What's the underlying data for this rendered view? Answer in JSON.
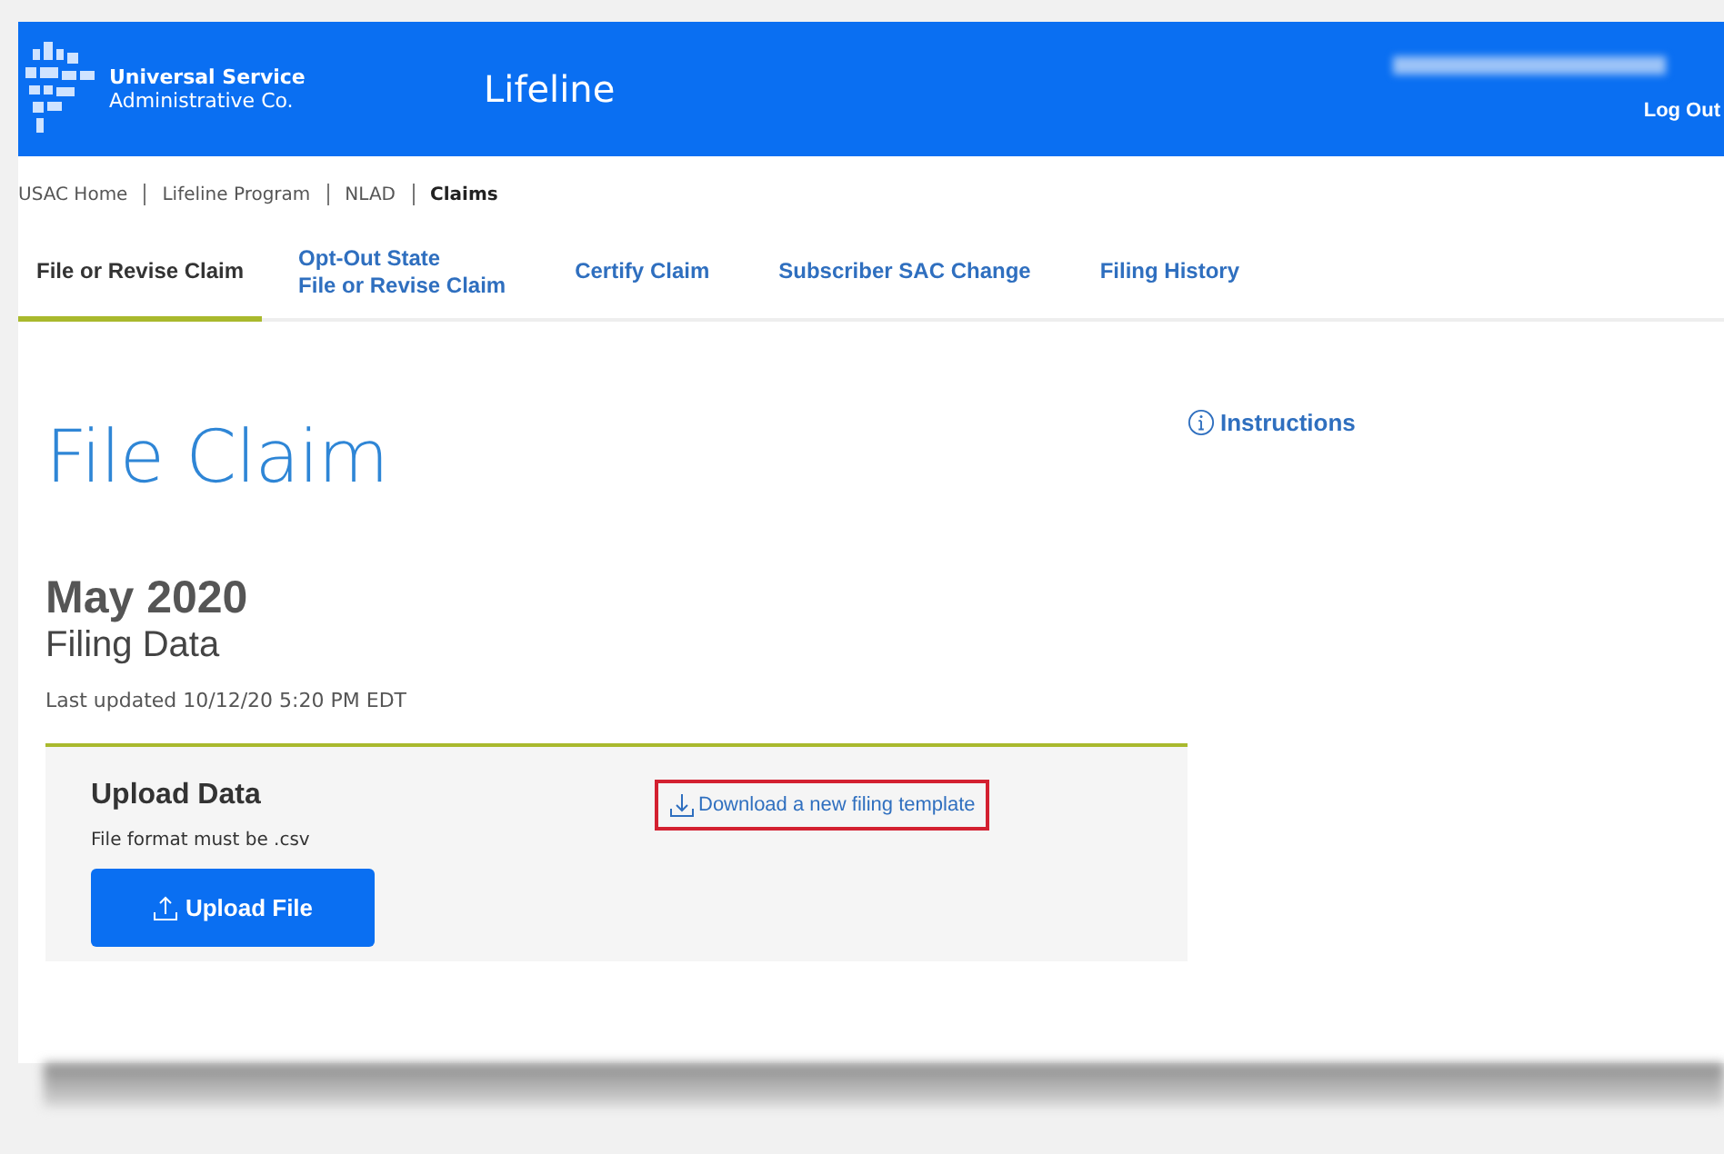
{
  "header": {
    "org_line_1": "Universal Service",
    "org_line_2": "Administrative Co.",
    "app_title": "Lifeline",
    "logout": "Log Out"
  },
  "breadcrumbs": [
    {
      "label": "USAC Home",
      "current": false
    },
    {
      "label": "Lifeline Program",
      "current": false
    },
    {
      "label": "NLAD",
      "current": false
    },
    {
      "label": "Claims",
      "current": true
    }
  ],
  "tabs": [
    {
      "lines": [
        "File or Revise Claim"
      ],
      "selected": true
    },
    {
      "lines": [
        "Opt-Out State",
        "File or Revise Claim"
      ],
      "selected": false
    },
    {
      "lines": [
        "Certify Claim"
      ],
      "selected": false
    },
    {
      "lines": [
        "Subscriber SAC Change"
      ],
      "selected": false
    },
    {
      "lines": [
        "Filing History"
      ],
      "selected": false
    }
  ],
  "page_title": "File Claim",
  "instructions_link": "Instructions",
  "period": "May 2020",
  "subtitle": "Filing Data",
  "last_updated": "Last updated 10/12/20 5:20 PM EDT",
  "upload_panel": {
    "title": "Upload Data",
    "note": "File format must be .csv",
    "button": "Upload File",
    "template_link": "Download a new filing template",
    "template_link_highlighted": true
  }
}
